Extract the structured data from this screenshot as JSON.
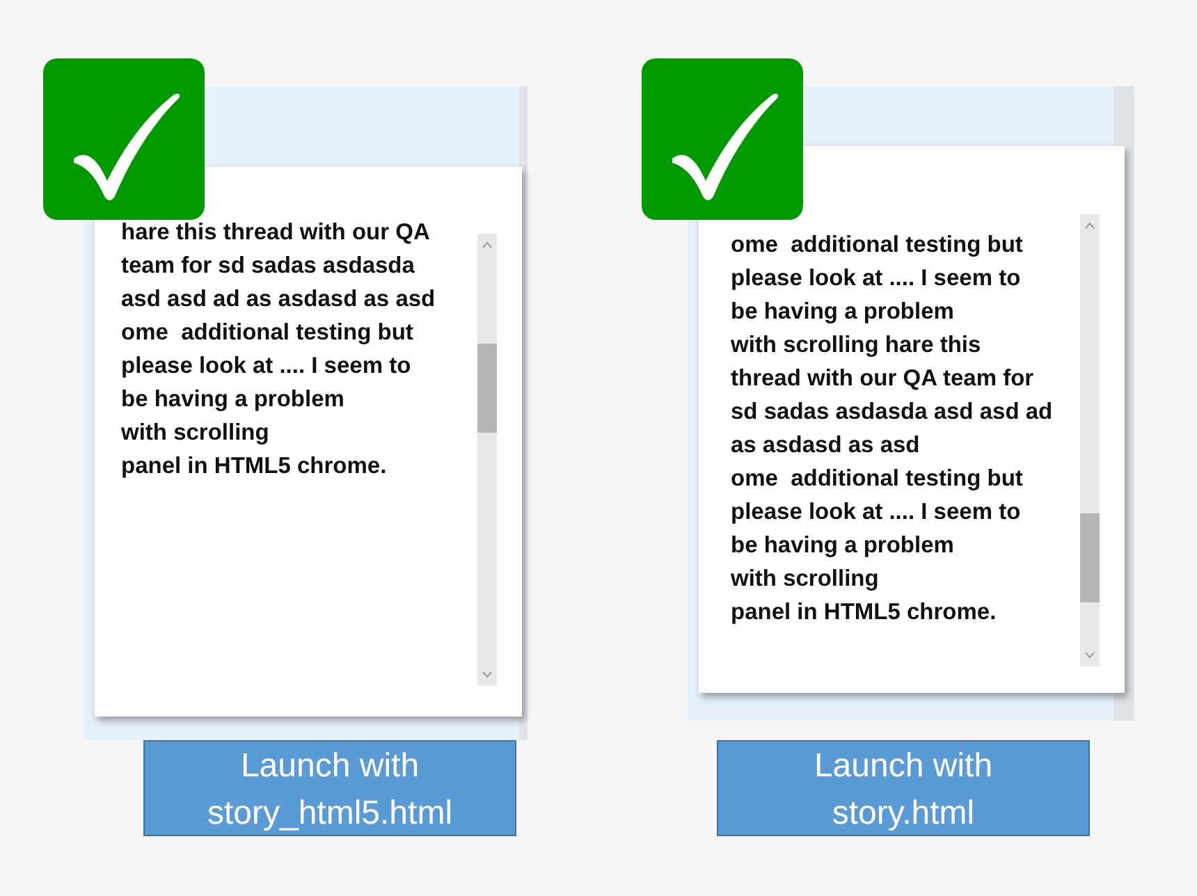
{
  "panels": [
    {
      "lines": [
        "hare this thread with our QA",
        "team for sd sadas asdasda",
        "asd asd ad as asdasd as asd",
        "ome  additional testing but",
        "please look at .... I seem to",
        "be having a problem",
        "with scrolling",
        "panel in HTML5 chrome."
      ],
      "caption": [
        "Launch with",
        "story_html5.html"
      ]
    },
    {
      "lines": [
        "ome  additional testing but",
        "please look at .... I seem to",
        "be having a problem",
        "with scrolling hare this",
        "thread with our QA team for",
        "sd sadas asdasda asd asd ad",
        "as asdasd as asd",
        "ome  additional testing but",
        "please look at .... I seem to",
        "be having a problem",
        "with scrolling",
        "panel in HTML5 chrome."
      ],
      "caption": [
        "Launch with",
        "story.html"
      ]
    }
  ]
}
